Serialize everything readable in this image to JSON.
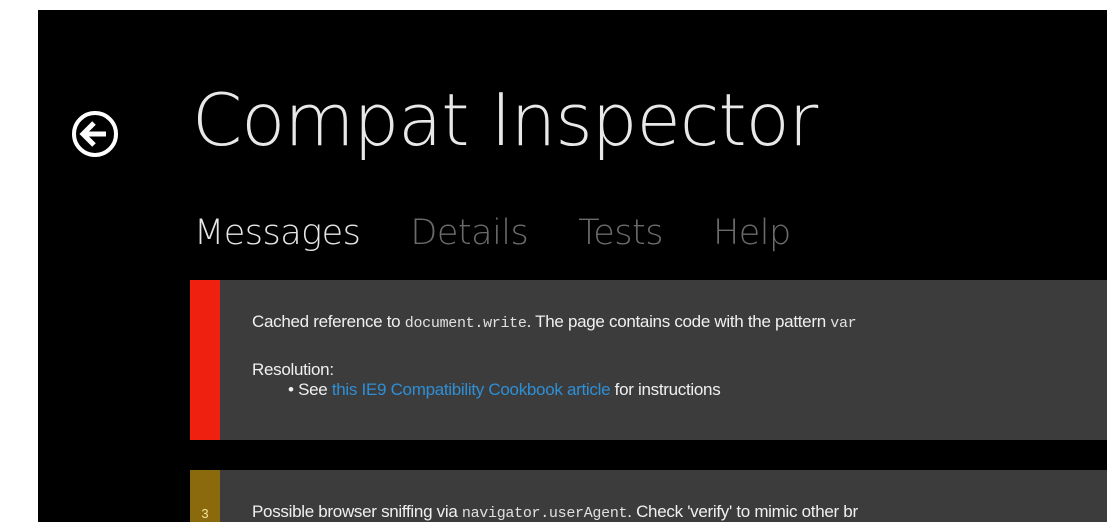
{
  "app": {
    "title": "Compat Inspector"
  },
  "tabs": [
    {
      "label": "Messages",
      "active": true
    },
    {
      "label": "Details",
      "active": false
    },
    {
      "label": "Tests",
      "active": false
    },
    {
      "label": "Help",
      "active": false
    }
  ],
  "messages": [
    {
      "severity_color": "#f02010",
      "severity_number": "",
      "text_before": "Cached reference to ",
      "code": "document.write",
      "text_after": ". The page contains code with the pattern ",
      "code_tail": "var",
      "resolution_label": "Resolution:",
      "resolution_prefix": "• See ",
      "resolution_link": "this IE9 Compatibility Cookbook article",
      "resolution_suffix": " for instructions"
    },
    {
      "severity_color": "#8a6a0c",
      "severity_number": "3",
      "text_before": "Possible browser sniffing via ",
      "code": "navigator.userAgent",
      "text_after": ". Check 'verify' to mimic other br"
    }
  ],
  "colors": {
    "background": "#000000",
    "card": "#3c3c3c",
    "link": "#2e8fd6"
  },
  "icons": {
    "back": "back-arrow-circle-icon"
  }
}
